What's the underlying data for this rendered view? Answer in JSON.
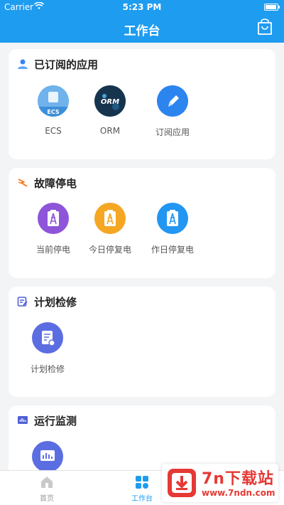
{
  "status": {
    "carrier": "Carrier",
    "time": "5:23 PM",
    "battery_level": 0.95
  },
  "header": {
    "title": "工作台",
    "right_icon": "shopping-bag-icon"
  },
  "sections": [
    {
      "title": "已订阅的应用",
      "icon": "user-icon",
      "apps": [
        {
          "label": "ECS",
          "icon": "ecs-logo-icon"
        },
        {
          "label": "ORM",
          "icon": "orm-logo-icon"
        },
        {
          "label": "订阅应用",
          "icon": "pencil-icon"
        }
      ]
    },
    {
      "title": "故障停电",
      "icon": "lightning-icon",
      "apps": [
        {
          "label": "当前停电",
          "icon": "power-tower-clipboard-icon",
          "color": "#8e54d9"
        },
        {
          "label": "今日停复电",
          "icon": "power-tower-clipboard-icon",
          "color": "#f5a623"
        },
        {
          "label": "作日停复电",
          "icon": "power-tower-clipboard-icon",
          "color": "#2196f3"
        }
      ]
    },
    {
      "title": "计划检修",
      "icon": "plan-edit-icon",
      "apps": [
        {
          "label": "计划检修",
          "icon": "document-wrench-icon",
          "color": "#5b6ee1"
        }
      ]
    },
    {
      "title": "运行监测",
      "icon": "monitor-chart-icon",
      "apps": [
        {
          "label": "",
          "icon": "monitor-chart-icon",
          "color": "#5b6ee1"
        }
      ]
    }
  ],
  "tabbar": {
    "tabs": [
      {
        "label": "首页",
        "icon": "home-icon",
        "active": false
      },
      {
        "label": "工作台",
        "icon": "grid-icon",
        "active": true
      }
    ]
  },
  "watermark": {
    "logo_text": "7n下载站",
    "url": "www.7ndn.com"
  },
  "colors": {
    "primary": "#1e9cf0",
    "background": "#f3f4f6"
  }
}
